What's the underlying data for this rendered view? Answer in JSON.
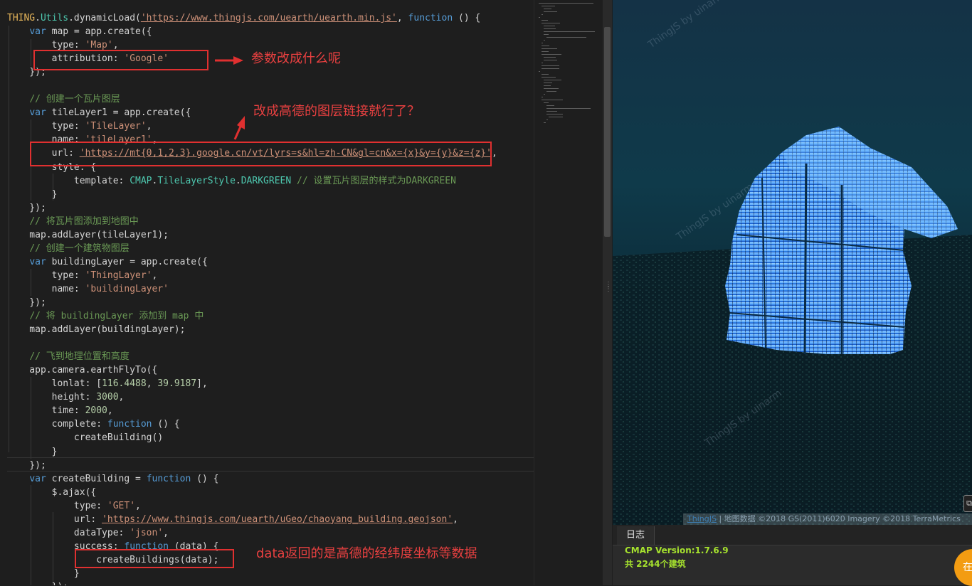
{
  "code_lines": [
    [
      [
        "obj",
        "THING"
      ],
      [
        "",
        "."
      ],
      [
        "cls",
        "Utils"
      ],
      [
        "",
        ".dynamicLoad("
      ],
      [
        "url",
        "'https://www.thingjs.com/uearth/uearth.min.js'"
      ],
      [
        "",
        ", "
      ],
      [
        "kw",
        "function"
      ],
      [
        "",
        " () {"
      ]
    ],
    [
      [
        "",
        "    "
      ],
      [
        "kw",
        "var"
      ],
      [
        "",
        " map = app.create({"
      ]
    ],
    [
      [
        "",
        "        type: "
      ],
      [
        "str",
        "'Map'"
      ],
      [
        "",
        ","
      ]
    ],
    [
      [
        "",
        "        attribution: "
      ],
      [
        "str",
        "'Google'"
      ]
    ],
    [
      [
        "",
        "    });"
      ]
    ],
    [
      [
        "",
        ""
      ]
    ],
    [
      [
        "",
        "    "
      ],
      [
        "cmt",
        "// 创建一个瓦片图层"
      ]
    ],
    [
      [
        "",
        "    "
      ],
      [
        "kw",
        "var"
      ],
      [
        "",
        " tileLayer1 = app.create({"
      ]
    ],
    [
      [
        "",
        "        type: "
      ],
      [
        "str",
        "'TileLayer'"
      ],
      [
        "",
        ","
      ]
    ],
    [
      [
        "",
        "        name: "
      ],
      [
        "str",
        "'tileLayer1'"
      ],
      [
        "",
        ","
      ]
    ],
    [
      [
        "",
        "        url: "
      ],
      [
        "url",
        "'https://mt{0,1,2,3}.google.cn/vt/lyrs=s&hl=zh-CN&gl=cn&x={x}&y={y}&z={z}'"
      ],
      [
        "",
        ","
      ]
    ],
    [
      [
        "",
        "        style: {"
      ]
    ],
    [
      [
        "",
        "            template: "
      ],
      [
        "cls",
        "CMAP"
      ],
      [
        "",
        "."
      ],
      [
        "cls",
        "TileLayerStyle"
      ],
      [
        "",
        "."
      ],
      [
        "cls",
        "DARKGREEN"
      ],
      [
        "",
        " "
      ],
      [
        "cmt",
        "// 设置瓦片图层的样式为DARKGREEN"
      ]
    ],
    [
      [
        "",
        "        }"
      ]
    ],
    [
      [
        "",
        "    });"
      ]
    ],
    [
      [
        "",
        "    "
      ],
      [
        "cmt",
        "// 将瓦片图添加到地图中"
      ]
    ],
    [
      [
        "",
        "    map.addLayer(tileLayer1);"
      ]
    ],
    [
      [
        "",
        "    "
      ],
      [
        "cmt",
        "// 创建一个建筑物图层"
      ]
    ],
    [
      [
        "",
        "    "
      ],
      [
        "kw",
        "var"
      ],
      [
        "",
        " buildingLayer = app.create({"
      ]
    ],
    [
      [
        "",
        "        type: "
      ],
      [
        "str",
        "'ThingLayer'"
      ],
      [
        "",
        ","
      ]
    ],
    [
      [
        "",
        "        name: "
      ],
      [
        "str",
        "'buildingLayer'"
      ]
    ],
    [
      [
        "",
        "    });"
      ]
    ],
    [
      [
        "",
        "    "
      ],
      [
        "cmt",
        "// 将 buildingLayer 添加到 map 中"
      ]
    ],
    [
      [
        "",
        "    map.addLayer(buildingLayer);"
      ]
    ],
    [
      [
        "",
        ""
      ]
    ],
    [
      [
        "",
        "    "
      ],
      [
        "cmt",
        "// 飞到地理位置和高度"
      ]
    ],
    [
      [
        "",
        "    app.camera.earthFlyTo({"
      ]
    ],
    [
      [
        "",
        "        lonlat: ["
      ],
      [
        "num",
        "116.4488"
      ],
      [
        "",
        ", "
      ],
      [
        "num",
        "39.9187"
      ],
      [
        "",
        "],"
      ]
    ],
    [
      [
        "",
        "        height: "
      ],
      [
        "num",
        "3000"
      ],
      [
        "",
        ","
      ]
    ],
    [
      [
        "",
        "        time: "
      ],
      [
        "num",
        "2000"
      ],
      [
        "",
        ","
      ]
    ],
    [
      [
        "",
        "        complete: "
      ],
      [
        "kw",
        "function"
      ],
      [
        "",
        " () {"
      ]
    ],
    [
      [
        "",
        "            createBuilding()"
      ]
    ],
    [
      [
        "",
        "        }"
      ]
    ],
    [
      [
        "",
        "    });"
      ]
    ],
    [
      [
        "",
        "    "
      ],
      [
        "kw",
        "var"
      ],
      [
        "",
        " createBuilding = "
      ],
      [
        "kw",
        "function"
      ],
      [
        "",
        " () {"
      ]
    ],
    [
      [
        "",
        "        $.ajax({"
      ]
    ],
    [
      [
        "",
        "            type: "
      ],
      [
        "str",
        "'GET'"
      ],
      [
        "",
        ","
      ]
    ],
    [
      [
        "",
        "            url: "
      ],
      [
        "url",
        "'https://www.thingjs.com/uearth/uGeo/chaoyang_building.geojson'"
      ],
      [
        "",
        ","
      ]
    ],
    [
      [
        "",
        "            dataType: "
      ],
      [
        "str",
        "'json'"
      ],
      [
        "",
        ","
      ]
    ],
    [
      [
        "",
        "            success: "
      ],
      [
        "kw",
        "function"
      ],
      [
        "",
        " (data) {"
      ]
    ],
    [
      [
        "",
        "                createBuildings(data);"
      ]
    ],
    [
      [
        "",
        "            }"
      ]
    ],
    [
      [
        "",
        "        });"
      ]
    ]
  ],
  "annotations": {
    "attribution_note": "参数改成什么呢",
    "url_note": "改成高德的图层链接就行了？",
    "data_note": "data返回的是高德的经纬度坐标等数据"
  },
  "viewer": {
    "watermark": "ThingJS by uinarm",
    "attribution_link": "ThingJS",
    "attribution_text": "| 地图数据 ©2018 GS(2011)6020 Imagery ©2018 TerraMetrics"
  },
  "log_panel": {
    "tab_label": "日志",
    "lines": [
      "CMAP Version:1.7.6.9",
      "共 2244个建筑"
    ],
    "help_label": "在线"
  },
  "colors": {
    "editor_bg": "#1e1e1e",
    "keyword": "#569cd6",
    "string": "#ce9178",
    "comment": "#6a9955",
    "number": "#b5cea8",
    "annotation": "#e03030",
    "log_text": "#a6e22e",
    "buildings": "#3fa0ff"
  }
}
